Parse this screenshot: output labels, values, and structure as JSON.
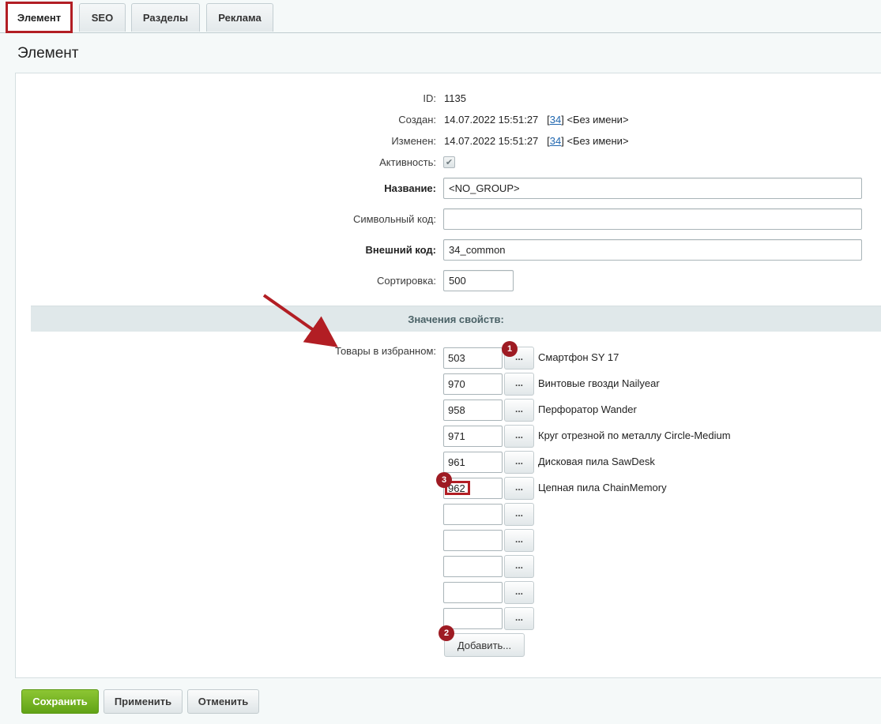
{
  "tabs": [
    {
      "label": "Элемент",
      "active": true
    },
    {
      "label": "SEO",
      "active": false
    },
    {
      "label": "Разделы",
      "active": false
    },
    {
      "label": "Реклама",
      "active": false
    }
  ],
  "panel_title": "Элемент",
  "fields": {
    "id_label": "ID:",
    "id_value": "1135",
    "created_label": "Создан:",
    "created_date": "14.07.2022 15:51:27",
    "created_user_id": "34",
    "created_user_name": "<Без имени>",
    "modified_label": "Изменен:",
    "modified_date": "14.07.2022 15:51:27",
    "modified_user_id": "34",
    "modified_user_name": "<Без имени>",
    "active_label": "Активность:",
    "active_checked": true,
    "name_label": "Название:",
    "name_value": "<NO_GROUP>",
    "code_label": "Символьный код:",
    "code_value": "",
    "xml_label": "Внешний код:",
    "xml_value": "34_common",
    "sort_label": "Сортировка:",
    "sort_value": "500"
  },
  "properties": {
    "header": "Значения свойств:",
    "favorites_label": "Товары в избранном:",
    "items": [
      {
        "id": "503",
        "name": "Смартфон SY 17"
      },
      {
        "id": "970",
        "name": "Винтовые гвозди Nailyear"
      },
      {
        "id": "958",
        "name": "Перфоратор Wander"
      },
      {
        "id": "971",
        "name": "Круг отрезной по металлу Circle-Medium"
      },
      {
        "id": "961",
        "name": "Дисковая пила SawDesk"
      },
      {
        "id": "962",
        "name": "Цепная пила ChainMemory"
      },
      {
        "id": "",
        "name": ""
      },
      {
        "id": "",
        "name": ""
      },
      {
        "id": "",
        "name": ""
      },
      {
        "id": "",
        "name": ""
      },
      {
        "id": "",
        "name": ""
      }
    ],
    "dots_label": "...",
    "add_label": "Добавить..."
  },
  "badges": [
    "1",
    "2",
    "3"
  ],
  "buttons": {
    "save": "Сохранить",
    "apply": "Применить",
    "cancel": "Отменить"
  },
  "colors": {
    "annotation_red": "#b21e24",
    "save_green": "#6fb125",
    "link_blue": "#2067b0"
  }
}
